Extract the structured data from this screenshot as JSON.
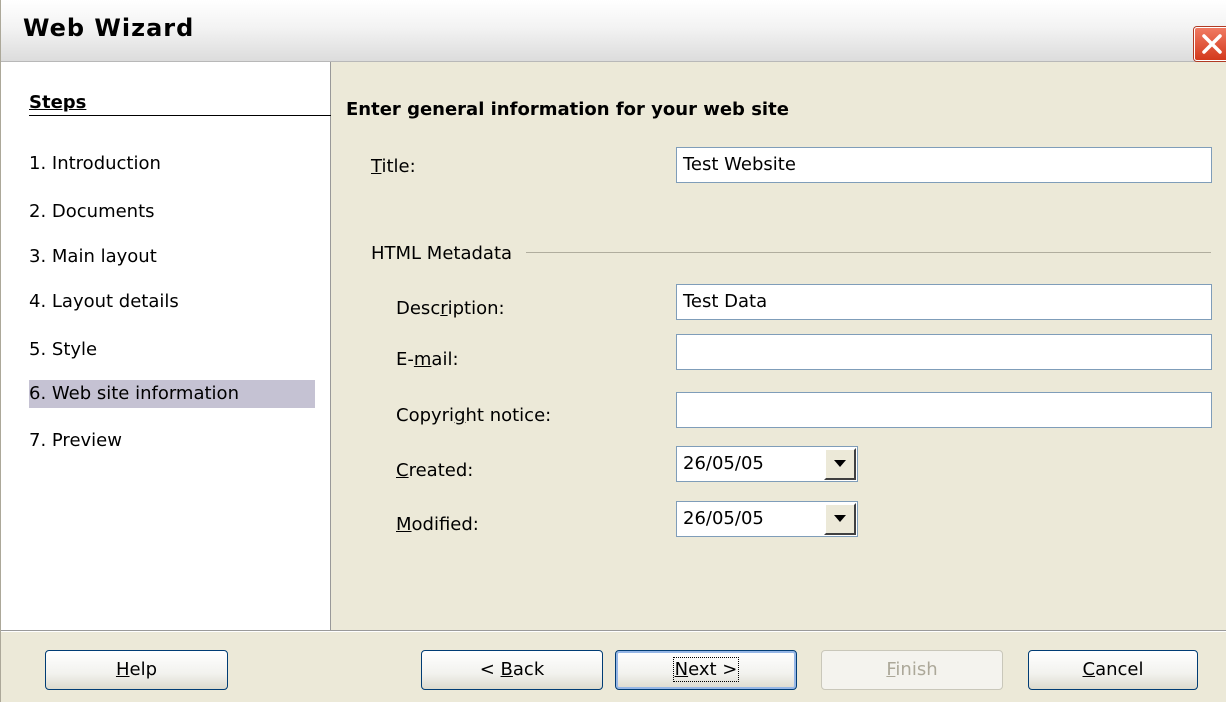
{
  "window": {
    "title": "Web Wizard"
  },
  "steps": {
    "heading": "Steps",
    "items": [
      "1.  Introduction",
      "2.  Documents",
      "3.  Main layout",
      "4.  Layout details",
      "5.  Style",
      "6.  Web site information",
      "7.  Preview"
    ],
    "active_index": 5
  },
  "main": {
    "heading": "Enter general information for your web site",
    "title_label": "Title:",
    "title_value": "Test Website",
    "group_label": "HTML Metadata",
    "description_label": "Description:",
    "description_value": "Test Data",
    "email_label": "E-mail:",
    "email_value": "",
    "copyright_label": "Copyright notice:",
    "copyright_value": "",
    "created_label": "Created:",
    "created_value": "26/05/05",
    "modified_label": "Modified:",
    "modified_value": "26/05/05"
  },
  "buttons": {
    "help": "Help",
    "back": "< Back",
    "next": "Next >",
    "finish": "Finish",
    "cancel": "Cancel"
  },
  "icons": {
    "close": "close-icon",
    "dropdown": "chevron-down-icon"
  }
}
